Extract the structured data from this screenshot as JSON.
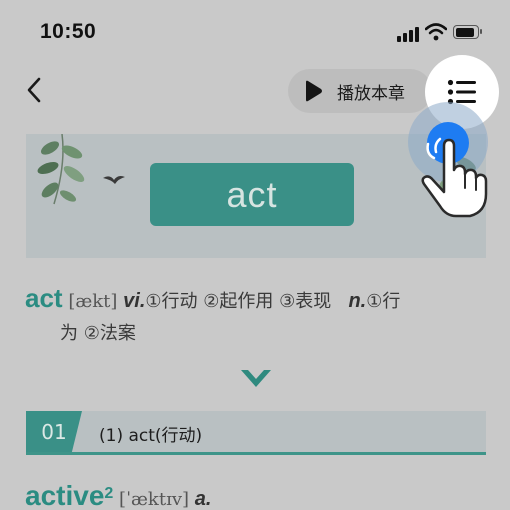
{
  "status_bar": {
    "time": "10:50",
    "battery_level": 0.9
  },
  "nav": {
    "play_label": "播放本章"
  },
  "banner": {
    "word": "act"
  },
  "entry": {
    "headword": "act",
    "phonetic": "[ækt]",
    "pos1": "vi.",
    "meaning1": "①行动 ②起作用 ③表现",
    "pos2": "n.",
    "meaning2a": "①行",
    "meaning2b": "为 ②法案"
  },
  "section": {
    "number": "01",
    "title": "(1) act(行动)"
  },
  "entry2": {
    "headword": "active",
    "superscript": "2",
    "phonetic": "[ˈæktɪv]",
    "pos": "a."
  },
  "colors": {
    "accent": "#3a9087",
    "overlay_bg": "#c9c9c9",
    "tap_dot": "#1e7cf2"
  },
  "icons": [
    "back-icon",
    "play-icon",
    "list-menu-icon",
    "chevron-down-icon",
    "hand-pointer-icon",
    "leaf-decoration",
    "bird-decoration"
  ]
}
